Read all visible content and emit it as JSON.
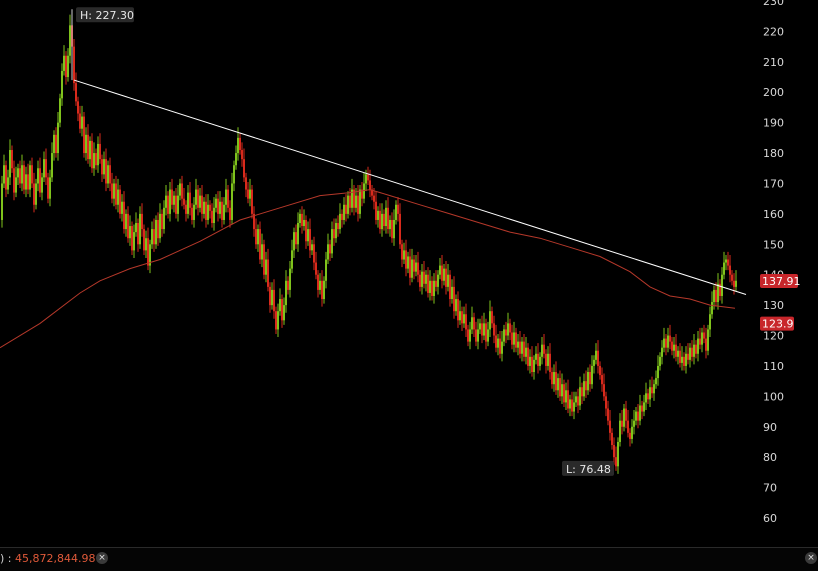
{
  "chart_data": {
    "type": "candlestick",
    "y_ticks": [
      "230",
      "220",
      "210",
      "200",
      "190",
      "180",
      "170",
      "160",
      "150",
      "140",
      "130",
      "120",
      "110",
      "100",
      "90",
      "80",
      "70",
      "60"
    ],
    "ylim": [
      55,
      230
    ],
    "grid": false,
    "high_marker": "H: 227.30",
    "low_marker": "L: 76.48",
    "high_value": 227.3,
    "low_value": 76.48,
    "last_price_label": "137.91",
    "last_price": 137.91,
    "moving_average_label": "123.9",
    "moving_average_value": 123.9,
    "colors": {
      "up": "#7fc31c",
      "down": "#d92a1c",
      "moving_average": "#b5382a",
      "trendline": "#ffffff",
      "price_tag": "#c8262b"
    },
    "trendline": {
      "start_value": 204,
      "end_value": 133.5
    },
    "ohlc_path": [
      [
        0,
        158
      ],
      [
        2,
        170
      ],
      [
        4,
        176
      ],
      [
        6,
        168
      ],
      [
        8,
        172
      ],
      [
        10,
        181
      ],
      [
        12,
        175
      ],
      [
        14,
        167
      ],
      [
        16,
        172
      ],
      [
        18,
        175
      ],
      [
        20,
        170
      ],
      [
        22,
        176
      ],
      [
        24,
        168
      ],
      [
        26,
        173
      ],
      [
        28,
        168
      ],
      [
        30,
        176
      ],
      [
        32,
        170
      ],
      [
        34,
        163
      ],
      [
        36,
        170
      ],
      [
        38,
        175
      ],
      [
        40,
        167
      ],
      [
        42,
        172
      ],
      [
        44,
        178
      ],
      [
        46,
        172
      ],
      [
        48,
        165
      ],
      [
        50,
        172
      ],
      [
        52,
        180
      ],
      [
        54,
        186
      ],
      [
        56,
        180
      ],
      [
        58,
        190
      ],
      [
        60,
        198
      ],
      [
        62,
        207
      ],
      [
        64,
        212
      ],
      [
        66,
        205
      ],
      [
        68,
        212
      ],
      [
        70,
        222
      ],
      [
        72,
        215
      ],
      [
        74,
        203
      ],
      [
        76,
        197
      ],
      [
        78,
        193
      ],
      [
        80,
        188
      ],
      [
        82,
        192
      ],
      [
        84,
        180
      ],
      [
        86,
        186
      ],
      [
        88,
        178
      ],
      [
        90,
        184
      ],
      [
        92,
        175
      ],
      [
        94,
        180
      ],
      [
        96,
        176
      ],
      [
        98,
        183
      ],
      [
        100,
        178
      ],
      [
        102,
        173
      ],
      [
        104,
        178
      ],
      [
        106,
        170
      ],
      [
        108,
        176
      ],
      [
        110,
        170
      ],
      [
        112,
        165
      ],
      [
        114,
        170
      ],
      [
        116,
        163
      ],
      [
        118,
        168
      ],
      [
        120,
        160
      ],
      [
        122,
        164
      ],
      [
        124,
        155
      ],
      [
        126,
        160
      ],
      [
        128,
        152
      ],
      [
        130,
        156
      ],
      [
        132,
        148
      ],
      [
        134,
        154
      ],
      [
        136,
        157
      ],
      [
        138,
        150
      ],
      [
        140,
        160
      ],
      [
        142,
        155
      ],
      [
        144,
        148
      ],
      [
        146,
        152
      ],
      [
        148,
        143
      ],
      [
        150,
        150
      ],
      [
        152,
        155
      ],
      [
        154,
        150
      ],
      [
        156,
        158
      ],
      [
        158,
        152
      ],
      [
        160,
        160
      ],
      [
        162,
        155
      ],
      [
        164,
        162
      ],
      [
        166,
        166
      ],
      [
        168,
        160
      ],
      [
        170,
        168
      ],
      [
        172,
        163
      ],
      [
        174,
        166
      ],
      [
        176,
        160
      ],
      [
        178,
        166
      ],
      [
        180,
        170
      ],
      [
        182,
        165
      ],
      [
        184,
        163
      ],
      [
        186,
        160
      ],
      [
        188,
        167
      ],
      [
        190,
        162
      ],
      [
        192,
        158
      ],
      [
        194,
        163
      ],
      [
        196,
        168
      ],
      [
        198,
        162
      ],
      [
        200,
        166
      ],
      [
        202,
        160
      ],
      [
        204,
        164
      ],
      [
        206,
        158
      ],
      [
        208,
        163
      ],
      [
        210,
        161
      ],
      [
        212,
        157
      ],
      [
        214,
        162
      ],
      [
        216,
        165
      ],
      [
        218,
        160
      ],
      [
        220,
        164
      ],
      [
        222,
        158
      ],
      [
        224,
        163
      ],
      [
        226,
        168
      ],
      [
        228,
        162
      ],
      [
        230,
        158
      ],
      [
        232,
        170
      ],
      [
        234,
        176
      ],
      [
        236,
        180
      ],
      [
        238,
        185
      ],
      [
        240,
        181
      ],
      [
        242,
        178
      ],
      [
        244,
        172
      ],
      [
        246,
        168
      ],
      [
        248,
        165
      ],
      [
        250,
        168
      ],
      [
        252,
        160
      ],
      [
        254,
        155
      ],
      [
        256,
        150
      ],
      [
        258,
        155
      ],
      [
        260,
        145
      ],
      [
        262,
        150
      ],
      [
        264,
        140
      ],
      [
        266,
        145
      ],
      [
        268,
        136
      ],
      [
        270,
        130
      ],
      [
        272,
        135
      ],
      [
        274,
        128
      ],
      [
        276,
        122
      ],
      [
        278,
        128
      ],
      [
        280,
        132
      ],
      [
        282,
        125
      ],
      [
        284,
        130
      ],
      [
        286,
        138
      ],
      [
        288,
        135
      ],
      [
        290,
        142
      ],
      [
        292,
        148
      ],
      [
        294,
        154
      ],
      [
        296,
        150
      ],
      [
        298,
        157
      ],
      [
        300,
        160
      ],
      [
        302,
        156
      ],
      [
        304,
        158
      ],
      [
        306,
        151
      ],
      [
        308,
        155
      ],
      [
        310,
        148
      ],
      [
        312,
        150
      ],
      [
        314,
        144
      ],
      [
        316,
        140
      ],
      [
        318,
        135
      ],
      [
        320,
        138
      ],
      [
        322,
        132
      ],
      [
        324,
        138
      ],
      [
        326,
        145
      ],
      [
        328,
        150
      ],
      [
        330,
        147
      ],
      [
        332,
        155
      ],
      [
        334,
        152
      ],
      [
        336,
        157
      ],
      [
        338,
        155
      ],
      [
        340,
        160
      ],
      [
        342,
        158
      ],
      [
        344,
        163
      ],
      [
        346,
        160
      ],
      [
        348,
        166
      ],
      [
        350,
        162
      ],
      [
        352,
        168
      ],
      [
        354,
        162
      ],
      [
        356,
        166
      ],
      [
        358,
        160
      ],
      [
        360,
        168
      ],
      [
        362,
        165
      ],
      [
        364,
        170
      ],
      [
        366,
        173
      ],
      [
        368,
        171
      ],
      [
        370,
        168
      ],
      [
        372,
        166
      ],
      [
        374,
        164
      ],
      [
        376,
        158
      ],
      [
        378,
        161
      ],
      [
        380,
        155
      ],
      [
        382,
        160
      ],
      [
        384,
        156
      ],
      [
        386,
        162
      ],
      [
        388,
        155
      ],
      [
        390,
        158
      ],
      [
        392,
        152
      ],
      [
        394,
        158
      ],
      [
        396,
        163
      ],
      [
        398,
        160
      ],
      [
        400,
        150
      ],
      [
        402,
        145
      ],
      [
        404,
        148
      ],
      [
        406,
        142
      ],
      [
        408,
        146
      ],
      [
        410,
        139
      ],
      [
        412,
        145
      ],
      [
        414,
        141
      ],
      [
        416,
        144
      ],
      [
        418,
        140
      ],
      [
        420,
        136
      ],
      [
        422,
        141
      ],
      [
        424,
        137
      ],
      [
        426,
        140
      ],
      [
        428,
        134
      ],
      [
        430,
        138
      ],
      [
        432,
        133
      ],
      [
        434,
        138
      ],
      [
        436,
        136
      ],
      [
        438,
        140
      ],
      [
        440,
        143
      ],
      [
        442,
        138
      ],
      [
        444,
        142
      ],
      [
        446,
        136
      ],
      [
        448,
        140
      ],
      [
        450,
        132
      ],
      [
        452,
        136
      ],
      [
        454,
        128
      ],
      [
        456,
        132
      ],
      [
        458,
        125
      ],
      [
        460,
        128
      ],
      [
        462,
        124
      ],
      [
        464,
        127
      ],
      [
        466,
        122
      ],
      [
        468,
        118
      ],
      [
        470,
        122
      ],
      [
        472,
        126
      ],
      [
        474,
        122
      ],
      [
        476,
        118
      ],
      [
        478,
        122
      ],
      [
        480,
        124
      ],
      [
        482,
        120
      ],
      [
        484,
        124
      ],
      [
        486,
        118
      ],
      [
        488,
        122
      ],
      [
        490,
        128
      ],
      [
        492,
        124
      ],
      [
        494,
        120
      ],
      [
        496,
        116
      ],
      [
        498,
        119
      ],
      [
        500,
        114
      ],
      [
        502,
        118
      ],
      [
        504,
        122
      ],
      [
        506,
        120
      ],
      [
        508,
        124
      ],
      [
        510,
        121
      ],
      [
        512,
        117
      ],
      [
        514,
        121
      ],
      [
        516,
        116
      ],
      [
        518,
        118
      ],
      [
        520,
        114
      ],
      [
        522,
        118
      ],
      [
        524,
        113
      ],
      [
        526,
        116
      ],
      [
        528,
        110
      ],
      [
        530,
        113
      ],
      [
        532,
        108
      ],
      [
        534,
        112
      ],
      [
        536,
        114
      ],
      [
        538,
        110
      ],
      [
        540,
        113
      ],
      [
        542,
        117
      ],
      [
        544,
        114
      ],
      [
        546,
        110
      ],
      [
        548,
        114
      ],
      [
        550,
        108
      ],
      [
        552,
        104
      ],
      [
        554,
        108
      ],
      [
        556,
        102
      ],
      [
        558,
        106
      ],
      [
        560,
        100
      ],
      [
        562,
        104
      ],
      [
        564,
        98
      ],
      [
        566,
        102
      ],
      [
        568,
        96
      ],
      [
        570,
        99
      ],
      [
        572,
        95
      ],
      [
        574,
        98
      ],
      [
        576,
        100
      ],
      [
        578,
        97
      ],
      [
        580,
        103
      ],
      [
        582,
        100
      ],
      [
        584,
        105
      ],
      [
        586,
        102
      ],
      [
        588,
        108
      ],
      [
        590,
        104
      ],
      [
        592,
        110
      ],
      [
        594,
        112
      ],
      [
        596,
        115
      ],
      [
        598,
        110
      ],
      [
        600,
        107
      ],
      [
        602,
        104
      ],
      [
        604,
        100
      ],
      [
        606,
        96
      ],
      [
        608,
        92
      ],
      [
        610,
        88
      ],
      [
        612,
        84
      ],
      [
        614,
        80
      ],
      [
        616,
        77
      ],
      [
        618,
        85
      ],
      [
        620,
        92
      ],
      [
        622,
        90
      ],
      [
        624,
        96
      ],
      [
        626,
        92
      ],
      [
        628,
        88
      ],
      [
        630,
        86
      ],
      [
        632,
        90
      ],
      [
        634,
        92
      ],
      [
        636,
        95
      ],
      [
        638,
        92
      ],
      [
        640,
        97
      ],
      [
        642,
        95
      ],
      [
        644,
        98
      ],
      [
        646,
        101
      ],
      [
        648,
        99
      ],
      [
        650,
        103
      ],
      [
        652,
        101
      ],
      [
        654,
        104
      ],
      [
        656,
        106
      ],
      [
        658,
        110
      ],
      [
        660,
        113
      ],
      [
        662,
        116
      ],
      [
        664,
        119
      ],
      [
        666,
        116
      ],
      [
        668,
        120
      ],
      [
        670,
        118
      ],
      [
        672,
        115
      ],
      [
        674,
        117
      ],
      [
        676,
        113
      ],
      [
        678,
        115
      ],
      [
        680,
        111
      ],
      [
        682,
        113
      ],
      [
        684,
        110
      ],
      [
        686,
        114
      ],
      [
        688,
        112
      ],
      [
        690,
        116
      ],
      [
        692,
        113
      ],
      [
        694,
        117
      ],
      [
        696,
        114
      ],
      [
        698,
        119
      ],
      [
        700,
        117
      ],
      [
        702,
        121
      ],
      [
        704,
        119
      ],
      [
        706,
        115
      ],
      [
        708,
        122
      ],
      [
        710,
        127
      ],
      [
        712,
        131
      ],
      [
        714,
        135
      ],
      [
        716,
        131
      ],
      [
        718,
        137
      ],
      [
        720,
        133
      ],
      [
        722,
        140
      ],
      [
        724,
        144
      ],
      [
        726,
        145
      ],
      [
        728,
        143
      ],
      [
        730,
        140
      ],
      [
        732,
        138
      ],
      [
        734,
        136
      ],
      [
        736,
        138
      ]
    ],
    "ma_path": [
      [
        0,
        116
      ],
      [
        40,
        124
      ],
      [
        80,
        134
      ],
      [
        100,
        138
      ],
      [
        130,
        142
      ],
      [
        160,
        145
      ],
      [
        200,
        151
      ],
      [
        240,
        158
      ],
      [
        280,
        162
      ],
      [
        320,
        166
      ],
      [
        350,
        167
      ],
      [
        370,
        168
      ],
      [
        390,
        166
      ],
      [
        420,
        163
      ],
      [
        450,
        160
      ],
      [
        480,
        157
      ],
      [
        510,
        154
      ],
      [
        540,
        152
      ],
      [
        570,
        149
      ],
      [
        600,
        146
      ],
      [
        630,
        141
      ],
      [
        650,
        136
      ],
      [
        670,
        133
      ],
      [
        690,
        132
      ],
      [
        710,
        130
      ],
      [
        735,
        129
      ]
    ]
  },
  "status": {
    "prefix": ") :",
    "value": "45,872,844.98",
    "close_label": "×"
  }
}
